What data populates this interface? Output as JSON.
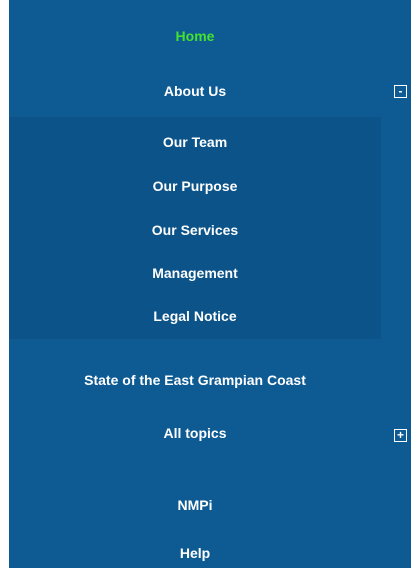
{
  "menu": {
    "items": [
      {
        "label": "Home"
      },
      {
        "label": "About Us",
        "toggle_icon": "collapse-icon",
        "toggle_glyph": "-"
      },
      {
        "label": "State of the East Grampian Coast"
      },
      {
        "label": "All topics",
        "toggle_icon": "expand-icon",
        "toggle_glyph": "+"
      },
      {
        "label": "NMPi"
      },
      {
        "label": "Help"
      }
    ],
    "about_submenu": [
      {
        "label": "Our Team"
      },
      {
        "label": "Our Purpose"
      },
      {
        "label": "Our Services"
      },
      {
        "label": "Management"
      },
      {
        "label": "Legal Notice"
      }
    ]
  },
  "colors": {
    "background": "#0e5b94",
    "submenu_background": "#0b5388",
    "active_item": "#45e12f",
    "text": "#ffffff"
  }
}
